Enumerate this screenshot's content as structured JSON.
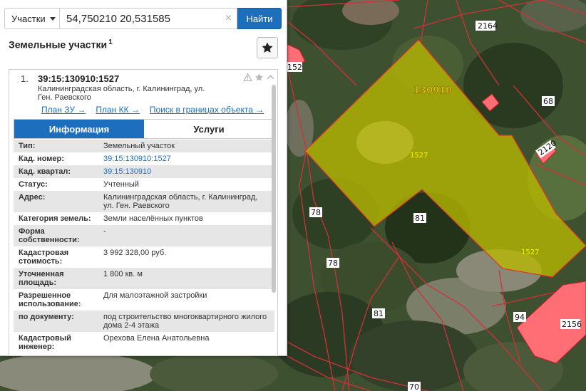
{
  "map": {
    "labels": {
      "l2164": "2164",
      "l152": "152",
      "l130910": "130910",
      "l68": "68",
      "l1527a": "1527",
      "l2120": "2120",
      "l78a": "78",
      "l81a": "81",
      "l1527b": "1527",
      "l78b": "78",
      "l81b": "81",
      "l94": "94",
      "l2156": "2156",
      "l70": "70"
    }
  },
  "search": {
    "type_label": "Участки",
    "query": "54,750210 20,531585",
    "clear_symbol": "×",
    "button_label": "Найти"
  },
  "panel": {
    "title": "Земельные участки",
    "count": "1"
  },
  "card": {
    "number": "1.",
    "cad_number": "39:15:130910:1527",
    "address": "Калининградская область, г. Калининград, ул. Ген. Раевского",
    "links": {
      "plan_zu": "План ЗУ →",
      "plan_kk": "План КК →",
      "search_within": "Поиск в границах объекта →"
    },
    "tabs": {
      "info": "Информация",
      "services": "Услуги"
    },
    "rows": [
      {
        "k": "Тип:",
        "v": "Земельный участок"
      },
      {
        "k": "Кад. номер:",
        "v": "39:15:130910:1527"
      },
      {
        "k": "Кад. квартал:",
        "v": "39:15:130910"
      },
      {
        "k": "Статус:",
        "v": "Учтенный"
      },
      {
        "k": "Адрес:",
        "v": "Калининградская область, г. Калининград, ул. Ген. Раевского"
      },
      {
        "k": "Категория земель:",
        "v": "Земли населённых пунктов"
      },
      {
        "k": "Форма собственности:",
        "v": "-"
      },
      {
        "k": "Кадастровая стоимость:",
        "v": "3 992 328,00 руб."
      },
      {
        "k": "Уточненная площадь:",
        "v": "1 800 кв. м"
      },
      {
        "k": "Разрешенное использование:",
        "v": "Для малоэтажной застройки"
      },
      {
        "k": "по документу:",
        "v": "под строительство многоквартирного жилого дома 2-4 этажа"
      },
      {
        "k": "Кадастровый инженер:",
        "v": "Орехова Елена Анатольевна"
      }
    ]
  },
  "colors": {
    "accent": "#1d6fbd",
    "parcel_fill": "#c8c800",
    "boundary": "#e0303c",
    "building_fill": "#ff6e74"
  }
}
